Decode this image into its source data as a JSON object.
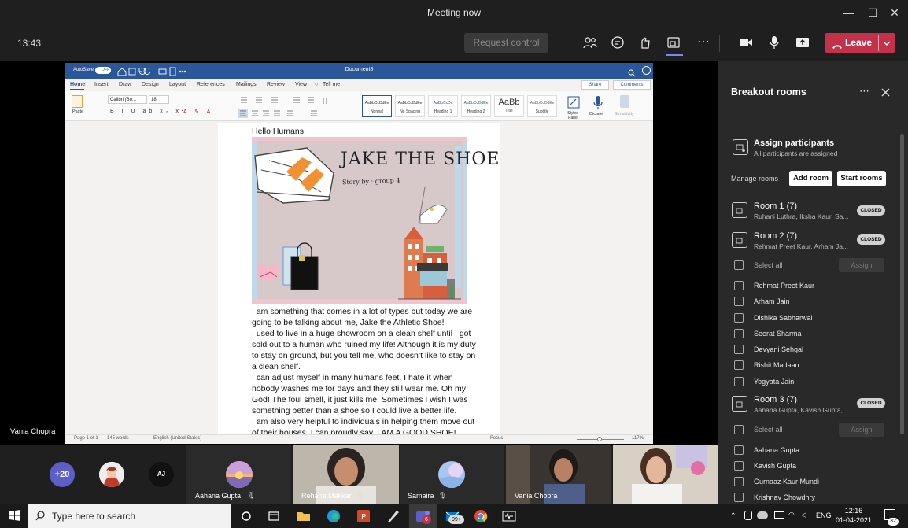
{
  "window": {
    "title": "Meeting now",
    "minimize": "—",
    "maximize": "☐",
    "close": "✕"
  },
  "toolbar": {
    "time": "13:43",
    "request_control": "Request control",
    "leave_label": "Leave",
    "more": "⋯"
  },
  "word": {
    "autosave": "AutoSave",
    "autosave_state": "OFF",
    "doc_title": "Document8",
    "tabs": [
      "Home",
      "Insert",
      "Draw",
      "Design",
      "Layout",
      "References",
      "Mailings",
      "Review",
      "View",
      "Tell me"
    ],
    "share": "Share",
    "comments": "Comments",
    "font": "Calibri (Bo...",
    "font_size": "18",
    "styles": [
      {
        "preview": "AaBbCcDdEe",
        "name": "Normal"
      },
      {
        "preview": "AaBbCcDdEe",
        "name": "No Spacing"
      },
      {
        "preview": "AaBbCcDc",
        "name": "Heading 1"
      },
      {
        "preview": "AaBbCcDdEe",
        "name": "Heading 2"
      },
      {
        "preview": "AaBb",
        "name": "Title"
      },
      {
        "preview": "AaBbCcDdEe",
        "name": "Subtitle"
      }
    ],
    "styles_pane": "Styles Pane",
    "dictate": "Dictate",
    "sensitivity": "Sensitivity",
    "heading": "Hello Humans!",
    "image_title": "JAKE THE SHOE",
    "image_subtitle": "Story by : group 4",
    "paragraphs": [
      "I am something that comes in a lot of types but today we are going to be talking about me, Jake the Athletic Shoe!",
      "I used to live in a huge showroom on a clean shelf until I got sold out to a human who ruined my life! Although it is my duty to stay on ground, but you tell me, who doesn’t like to stay on a clean shelf.",
      "I can adjust myself in many humans feet. I hate it when nobody washes me for days and they still wear me. Oh my God! The foul smell, it just kills me. Sometimes I wish I was something better than a shoe so I could live a better life.",
      "I am also very helpful to individuals in helping them move out of their houses. I can proudly say, I AM A GOOD SHOE!"
    ],
    "status": {
      "page": "Page 1 of 1",
      "words": "145 words",
      "lang": "English (United States)",
      "focus": "Focus",
      "zoom": "117%"
    }
  },
  "presenter": "Vania Chopra",
  "panel": {
    "title": "Breakout rooms",
    "assign_title": "Assign participants",
    "assign_sub": "All participants are assigned",
    "manage": "Manage rooms",
    "add_room": "Add room",
    "start_rooms": "Start rooms",
    "closed": "CLOSED",
    "select_all": "Select all",
    "assign": "Assign",
    "rooms": [
      {
        "name": "Room 1 (7)",
        "members": "Ruhani Luthra, Iksha Kaur, Sa..."
      },
      {
        "name": "Room 2 (7)",
        "members": "Rehmat Preet Kaur, Arham Ja..."
      },
      {
        "name": "Room 3 (7)",
        "members": "Aahana Gupta, Kavish Gupta,..."
      }
    ],
    "room2_people": [
      "Rehmat Preet Kaur",
      "Arham Jain",
      "Dishika Sabharwal",
      "Seerat Sharma",
      "Devyani Sehgal",
      "Rishit Madaan",
      "Yogyata Jain"
    ],
    "room3_people": [
      "Aahana Gupta",
      "Kavish Gupta",
      "Gurnaaz Kaur Mundi",
      "Krishnav Chowdhry"
    ]
  },
  "strip": {
    "overflow": "+20",
    "initials": "AJ",
    "names": [
      "Aahana Gupta",
      "Rehana Makkar",
      "Samaira",
      "Vania Chopra"
    ]
  },
  "taskbar": {
    "search": "Type here to search",
    "teams_badge": "6",
    "mail_badge": "99+",
    "lang": "ENG",
    "time": "12:16",
    "date": "01-04-2021",
    "notif": "32"
  }
}
